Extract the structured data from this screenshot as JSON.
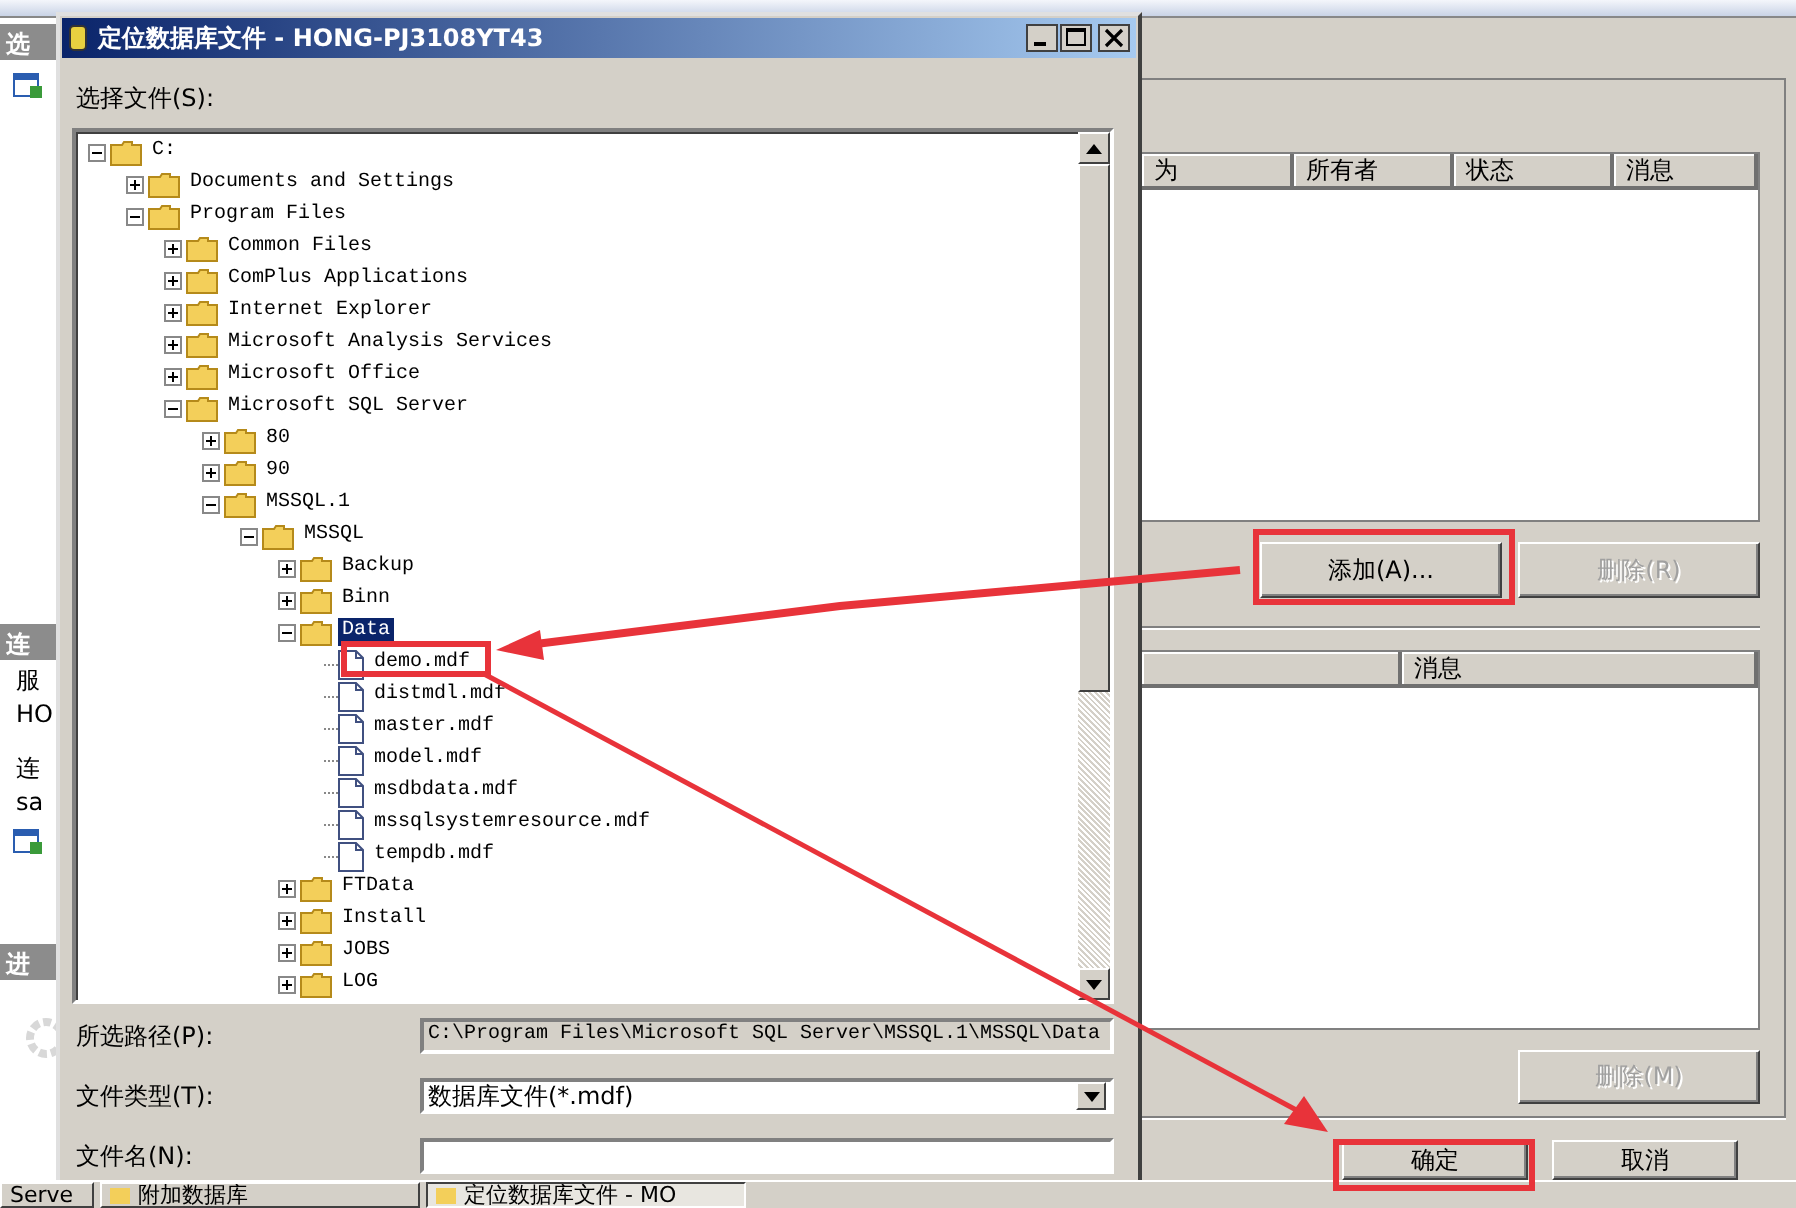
{
  "background_window": {
    "left_panel": [
      {
        "header": "选",
        "items": [
          {
            "kind": "icon"
          }
        ]
      },
      {
        "header": "连",
        "items": [
          {
            "kind": "text",
            "text": "服"
          },
          {
            "kind": "text",
            "text": "HO"
          },
          {
            "kind": "gap"
          },
          {
            "kind": "text",
            "text": "连"
          },
          {
            "kind": "text",
            "text": "sa"
          },
          {
            "kind": "icon"
          }
        ]
      },
      {
        "header": "进",
        "items": [
          {
            "kind": "spinner"
          }
        ]
      }
    ],
    "files_table": {
      "columns": [
        "为",
        "所有者",
        "状态",
        "消息"
      ]
    },
    "file_buttons": [
      {
        "label": "添加(A)...",
        "disabled": false
      },
      {
        "label": "删除(R)",
        "disabled": true
      }
    ],
    "details_table": {
      "columns": [
        "消息"
      ]
    },
    "remove_button": {
      "label": "删除(M)",
      "disabled": true
    },
    "dialog_buttons": [
      {
        "label": "确定"
      },
      {
        "label": "取消"
      }
    ]
  },
  "dialog": {
    "title": "定位数据库文件 - HONG-PJ3108YT43",
    "tree_label": "选择文件(S):",
    "tree": [
      {
        "kind": "folder",
        "name": "C:",
        "expanded": true,
        "selected": false,
        "children": [
          {
            "kind": "folder",
            "name": "Documents and Settings",
            "expanded": false,
            "selected": false
          },
          {
            "kind": "folder",
            "name": "Program Files",
            "expanded": true,
            "selected": false,
            "children": [
              {
                "kind": "folder",
                "name": "Common Files",
                "expanded": false,
                "selected": false
              },
              {
                "kind": "folder",
                "name": "ComPlus Applications",
                "expanded": false,
                "selected": false
              },
              {
                "kind": "folder",
                "name": "Internet Explorer",
                "expanded": false,
                "selected": false
              },
              {
                "kind": "folder",
                "name": "Microsoft Analysis Services",
                "expanded": false,
                "selected": false
              },
              {
                "kind": "folder",
                "name": "Microsoft Office",
                "expanded": false,
                "selected": false
              },
              {
                "kind": "folder",
                "name": "Microsoft SQL Server",
                "expanded": true,
                "selected": false,
                "children": [
                  {
                    "kind": "folder",
                    "name": "80",
                    "expanded": false,
                    "selected": false
                  },
                  {
                    "kind": "folder",
                    "name": "90",
                    "expanded": false,
                    "selected": false
                  },
                  {
                    "kind": "folder",
                    "name": "MSSQL.1",
                    "expanded": true,
                    "selected": false,
                    "children": [
                      {
                        "kind": "folder",
                        "name": "MSSQL",
                        "expanded": true,
                        "selected": false,
                        "children": [
                          {
                            "kind": "folder",
                            "name": "Backup",
                            "expanded": false,
                            "selected": false
                          },
                          {
                            "kind": "folder",
                            "name": "Binn",
                            "expanded": false,
                            "selected": false
                          },
                          {
                            "kind": "folder",
                            "name": "Data",
                            "expanded": true,
                            "selected": true,
                            "children": [
                              {
                                "kind": "file",
                                "name": "demo.mdf",
                                "selected": false
                              },
                              {
                                "kind": "file",
                                "name": "distmdl.mdf",
                                "selected": false
                              },
                              {
                                "kind": "file",
                                "name": "master.mdf",
                                "selected": false
                              },
                              {
                                "kind": "file",
                                "name": "model.mdf",
                                "selected": false
                              },
                              {
                                "kind": "file",
                                "name": "msdbdata.mdf",
                                "selected": false
                              },
                              {
                                "kind": "file",
                                "name": "mssqlsystemresource.mdf",
                                "selected": false
                              },
                              {
                                "kind": "file",
                                "name": "tempdb.mdf",
                                "selected": false
                              }
                            ]
                          },
                          {
                            "kind": "folder",
                            "name": "FTData",
                            "expanded": false,
                            "selected": false
                          },
                          {
                            "kind": "folder",
                            "name": "Install",
                            "expanded": false,
                            "selected": false
                          },
                          {
                            "kind": "folder",
                            "name": "JOBS",
                            "expanded": false,
                            "selected": false
                          },
                          {
                            "kind": "folder",
                            "name": "LOG",
                            "expanded": false,
                            "selected": false
                          }
                        ]
                      }
                    ]
                  }
                ]
              }
            ]
          }
        ]
      }
    ],
    "path": {
      "label": "所选路径(P):",
      "value": "C:\\Program Files\\Microsoft SQL Server\\MSSQL.1\\MSSQL\\Data"
    },
    "file_type": {
      "label": "文件类型(T):",
      "value": "数据库文件(*.mdf)"
    },
    "file_name": {
      "label": "文件名(N):"
    }
  },
  "taskbar": [
    {
      "label": "Serve",
      "active": false
    },
    {
      "label": "附加数据库",
      "active": false
    },
    {
      "label": "定位数据库文件 - MO",
      "active": true
    }
  ]
}
